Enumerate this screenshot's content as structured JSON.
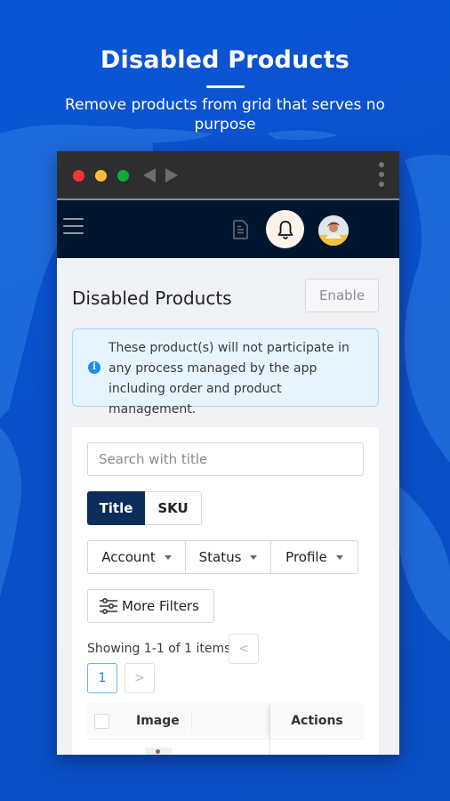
{
  "promo": {
    "title": "Disabled Products",
    "subtitle": "Remove products from grid that serves no purpose"
  },
  "browser": {
    "buttons": [
      "close",
      "minimize",
      "maximize"
    ],
    "nav": [
      "back",
      "forward"
    ],
    "menu_icon": "kebab-menu-icon"
  },
  "appbar": {
    "menu_icon": "hamburger-icon",
    "icons": [
      "document-icon",
      "bell-icon",
      "avatar"
    ]
  },
  "page": {
    "title": "Disabled Products",
    "enable_label": "Enable",
    "banner_text": "These product(s) will not participate in any process managed by the app including order and product management.",
    "banner_icon": "info-icon",
    "colors": {
      "appbar": "#00152e",
      "segment_active": "#0a2d5a",
      "info": "#1a8cf0",
      "page_link": "#1a7fe0"
    }
  },
  "grid": {
    "search_placeholder": "Search with title",
    "search_value": "",
    "search_by": [
      {
        "label": "Title",
        "active": true
      },
      {
        "label": "SKU",
        "active": false
      }
    ],
    "filters": [
      "Account",
      "Status",
      "Profile"
    ],
    "more_filters_label": "More Filters",
    "showing_text": "Showing 1-1 of 1 items",
    "pagination": {
      "prev": "<",
      "current": "1",
      "next": ">"
    },
    "columns": [
      "Image",
      "Actions"
    ]
  }
}
